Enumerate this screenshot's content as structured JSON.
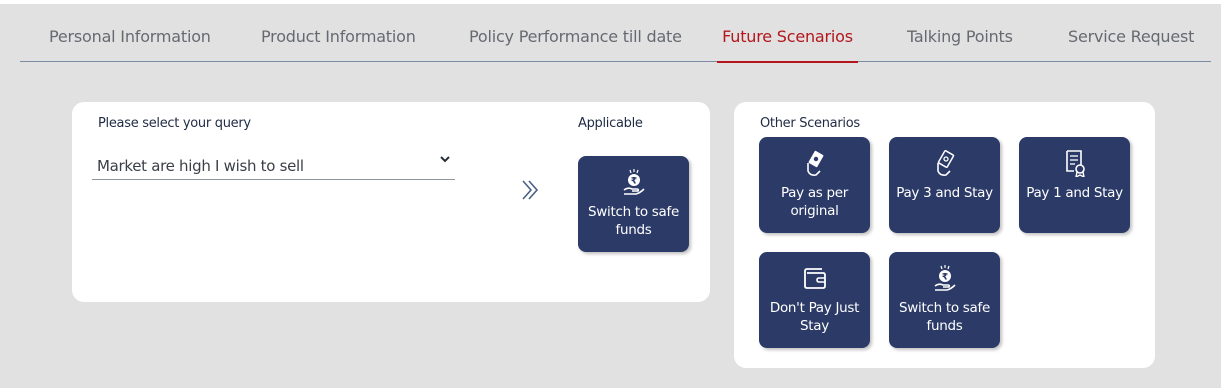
{
  "tabs": [
    {
      "label": "Personal Information",
      "active": false
    },
    {
      "label": "Product Information",
      "active": false
    },
    {
      "label": "Policy Performance till date",
      "active": false
    },
    {
      "label": "Future Scenarios",
      "active": true
    },
    {
      "label": "Talking Points",
      "active": false
    },
    {
      "label": "Service Request",
      "active": false
    }
  ],
  "query": {
    "label": "Please select your query",
    "selected": "Market are high I wish to sell"
  },
  "applicable": {
    "label": "Applicable",
    "tile": {
      "label": "Switch to safe funds",
      "icon": "rupee-hand-icon"
    }
  },
  "other": {
    "label": "Other Scenarios",
    "tiles": [
      {
        "label": "Pay as per original",
        "icon": "money-hand-icon"
      },
      {
        "label": "Pay 3 and Stay",
        "icon": "money-hand-icon"
      },
      {
        "label": "Pay 1 and Stay",
        "icon": "certificate-icon"
      },
      {
        "label": "Don't Pay Just Stay",
        "icon": "wallet-icon"
      },
      {
        "label": "Switch to safe funds",
        "icon": "rupee-hand-icon"
      }
    ]
  },
  "colors": {
    "accent": "#b3161c",
    "tile": "#2b3a67",
    "background": "#e1e1e1"
  }
}
